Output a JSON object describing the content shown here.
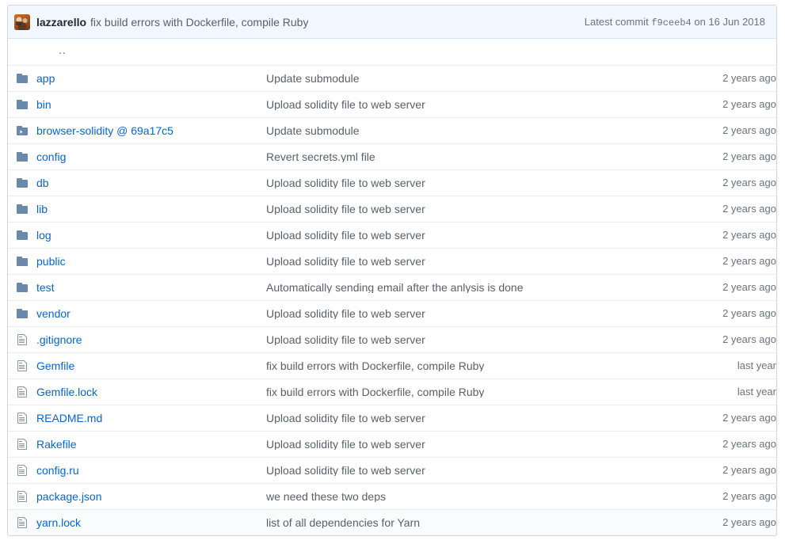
{
  "header": {
    "avatar_alt": "lazzarello-avatar",
    "author": "lazzarello",
    "message": "fix build errors with Dockerfile, compile Ruby",
    "meta_prefix": "Latest commit",
    "commit_sha": "f9ceeb4",
    "meta_suffix": "on 16 Jun 2018"
  },
  "up_directory": {
    "label": ".."
  },
  "colors": {
    "link": "#0366d6",
    "header_bg": "#f1f8ff",
    "border": "#d1d5da",
    "row_border": "#eaecef",
    "muted_text": "#586069",
    "folder_icon": "#6a89ad",
    "file_icon": "#8a93a0"
  },
  "files": [
    {
      "name": "app",
      "type": "folder",
      "message": "Update submodule",
      "age": "2 years ago"
    },
    {
      "name": "bin",
      "type": "folder",
      "message": "Upload solidity file to web server",
      "age": "2 years ago"
    },
    {
      "name": "browser-solidity @ 69a17c5",
      "type": "submodule",
      "message": "Update submodule",
      "age": "2 years ago"
    },
    {
      "name": "config",
      "type": "folder",
      "message": "Revert secrets.yml file",
      "age": "2 years ago"
    },
    {
      "name": "db",
      "type": "folder",
      "message": "Upload solidity file to web server",
      "age": "2 years ago"
    },
    {
      "name": "lib",
      "type": "folder",
      "message": "Upload solidity file to web server",
      "age": "2 years ago"
    },
    {
      "name": "log",
      "type": "folder",
      "message": "Upload solidity file to web server",
      "age": "2 years ago"
    },
    {
      "name": "public",
      "type": "folder",
      "message": "Upload solidity file to web server",
      "age": "2 years ago"
    },
    {
      "name": "test",
      "type": "folder",
      "message": "Automatically sending email after the anlysis is done",
      "age": "2 years ago"
    },
    {
      "name": "vendor",
      "type": "folder",
      "message": "Upload solidity file to web server",
      "age": "2 years ago"
    },
    {
      "name": ".gitignore",
      "type": "file",
      "message": "Upload solidity file to web server",
      "age": "2 years ago"
    },
    {
      "name": "Gemfile",
      "type": "file",
      "message": "fix build errors with Dockerfile, compile Ruby",
      "age": "last year"
    },
    {
      "name": "Gemfile.lock",
      "type": "file",
      "message": "fix build errors with Dockerfile, compile Ruby",
      "age": "last year"
    },
    {
      "name": "README.md",
      "type": "file",
      "message": "Upload solidity file to web server",
      "age": "2 years ago"
    },
    {
      "name": "Rakefile",
      "type": "file",
      "message": "Upload solidity file to web server",
      "age": "2 years ago"
    },
    {
      "name": "config.ru",
      "type": "file",
      "message": "Upload solidity file to web server",
      "age": "2 years ago"
    },
    {
      "name": "package.json",
      "type": "file",
      "message": "we need these two deps",
      "age": "2 years ago"
    },
    {
      "name": "yarn.lock",
      "type": "file",
      "message": "list of all dependencies for Yarn",
      "age": "2 years ago"
    }
  ]
}
